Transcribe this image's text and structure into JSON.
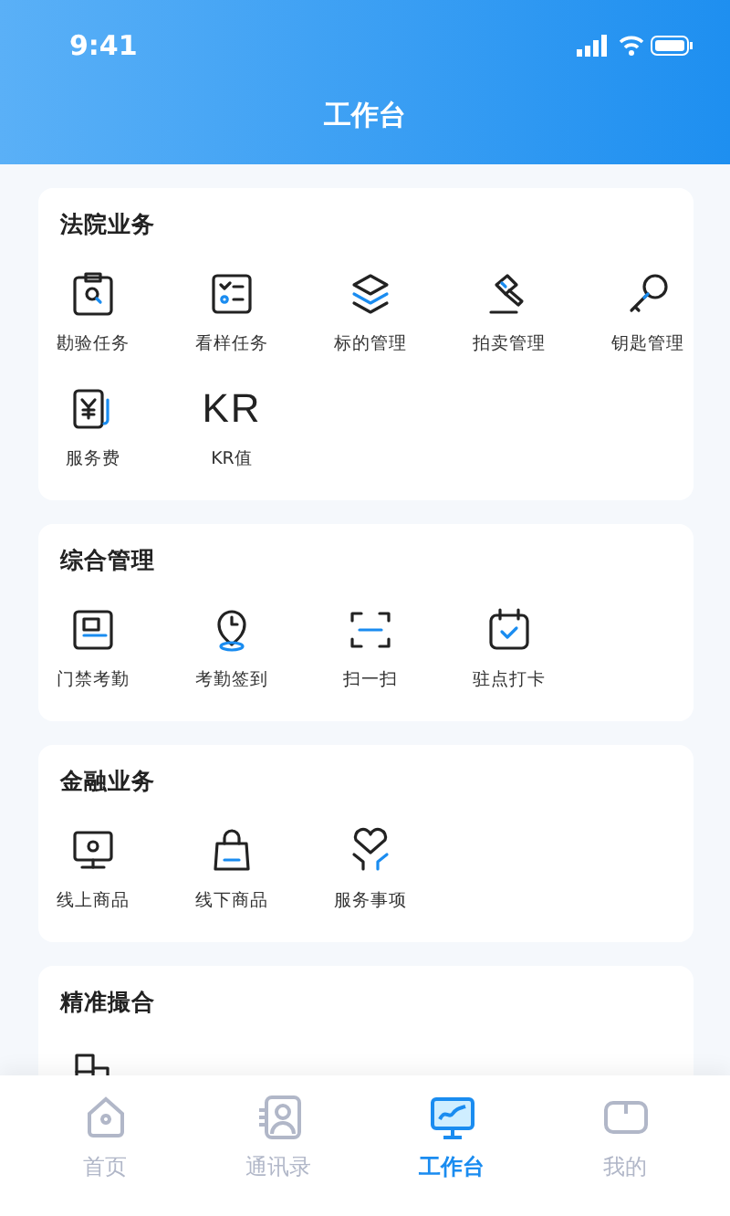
{
  "status_bar": {
    "time": "9:41"
  },
  "header": {
    "title": "工作台"
  },
  "sections": [
    {
      "title": "法院业务",
      "items": [
        {
          "kind": "icon",
          "label": "勘验任务"
        },
        {
          "kind": "icon",
          "label": "看样任务"
        },
        {
          "kind": "icon",
          "label": "标的管理"
        },
        {
          "kind": "icon",
          "label": "拍卖管理"
        },
        {
          "kind": "icon",
          "label": "钥匙管理"
        },
        {
          "kind": "icon",
          "label": "服务费"
        },
        {
          "kind": "glyph",
          "glyph": "KR",
          "label": "KR值"
        }
      ]
    },
    {
      "title": "综合管理",
      "items": [
        {
          "kind": "icon",
          "label": "门禁考勤"
        },
        {
          "kind": "icon",
          "label": "考勤签到"
        },
        {
          "kind": "icon",
          "label": "扫一扫"
        },
        {
          "kind": "icon",
          "label": "驻点打卡"
        }
      ]
    },
    {
      "title": "金融业务",
      "items": [
        {
          "kind": "icon",
          "label": "线上商品"
        },
        {
          "kind": "icon",
          "label": "线下商品"
        },
        {
          "kind": "icon",
          "label": "服务事项"
        }
      ]
    },
    {
      "title": "精准撮合",
      "items": [
        {
          "kind": "icon"
        }
      ]
    }
  ],
  "tab_bar": [
    {
      "label": "首页",
      "selected": false
    },
    {
      "label": "通讯录",
      "selected": false
    },
    {
      "label": "工作台",
      "selected": true
    },
    {
      "label": "我的",
      "selected": false
    }
  ]
}
